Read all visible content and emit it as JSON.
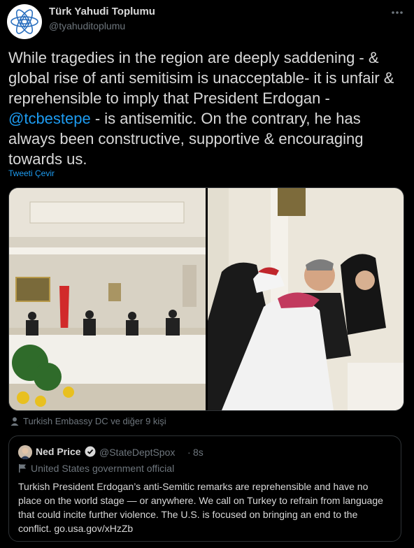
{
  "tweet": {
    "author_name": "Türk Yahudi Toplumu",
    "author_handle": "@tyahuditoplumu",
    "text_before": "While tragedies in the region are deeply saddening - & global rise of anti semitisim is unacceptable- it is unfair & reprehensible to imply that President Erdogan - ",
    "mention": "@tcbestepe",
    "text_after": " - is antisemitic. On the contrary, he has always been constructive, supportive & encouraging towards us.",
    "translate_label": "Tweeti Çevir",
    "tagged_people": "Turkish Embassy DC ve diğer 9 kişi",
    "more_icon": "more-icon",
    "link_color": "#1d9bf0"
  },
  "quote": {
    "author_name": "Ned Price",
    "author_handle": "@StateDeptSpox",
    "separator": "·",
    "time": "8s",
    "label": "United States government official",
    "text": "Turkish President Erdogan’s anti-Semitic remarks are reprehensible and have no place on the world stage — or anywhere. We call on Turkey to refrain from language that could incite further violence. The U.S. is focused on bringing an end to the conflict. go.usa.gov/xHzZb"
  }
}
